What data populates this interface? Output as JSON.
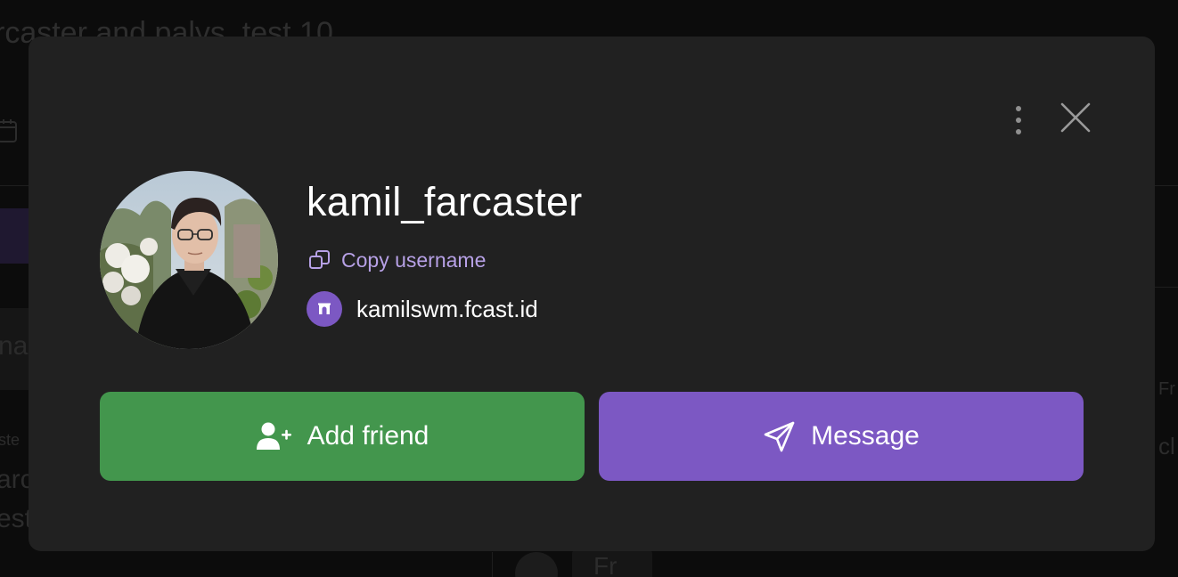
{
  "background": {
    "title_fragment": "rcaster and palys_test 10",
    "search_fragment": "na",
    "list_small_fragment": "ste",
    "list_line1_fragment": "arc",
    "list_line2_fragment": "est",
    "right_fragment_1": "Fr",
    "right_fragment_2": "cl",
    "bottom_fragment": "Fr"
  },
  "profile_modal": {
    "username": "kamil_farcaster",
    "copy_username_label": "Copy username",
    "fcast_id": "kamilswm.fcast.id",
    "add_friend_label": "Add friend",
    "message_label": "Message",
    "colors": {
      "modal_bg": "#212121",
      "add_friend": "#43964d",
      "message": "#7c58c3",
      "copy_link": "#b7a1e6",
      "fcast_badge": "#7c58c3"
    },
    "icons": {
      "more": "vertical-dots-icon",
      "close": "close-icon",
      "copy": "copy-icon",
      "fcast": "fcast-arch-icon",
      "add_friend": "user-plus-icon",
      "message": "send-icon"
    }
  }
}
